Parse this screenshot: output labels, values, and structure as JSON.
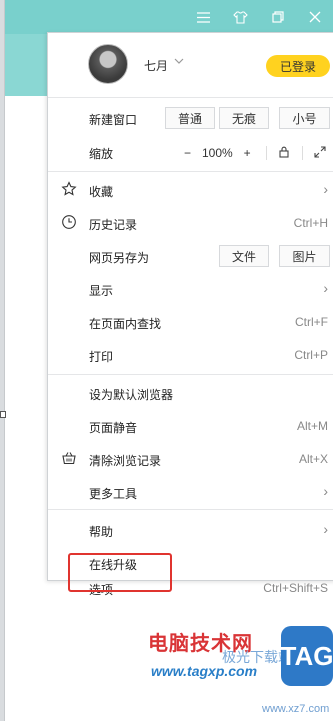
{
  "title_bar": {
    "icons": [
      "menu-icon",
      "skin-icon",
      "minimize-icon",
      "restore-icon",
      "close-icon"
    ],
    "color": "#79d0cc"
  },
  "profile": {
    "username": "七月",
    "login_label": "已登录",
    "login_color": "#ffd21f"
  },
  "new_window": {
    "label": "新建窗口",
    "options": [
      "普通",
      "无痕",
      "小号"
    ]
  },
  "zoom": {
    "label": "缩放",
    "minus": "−",
    "value": "100%",
    "plus": "+",
    "lock_icon": "lock-icon",
    "fullscreen_icon": "fullscreen-icon"
  },
  "items": [
    {
      "label": "收藏",
      "icon": "star-icon",
      "submenu": true
    },
    {
      "label": "历史记录",
      "icon": "clock-icon",
      "shortcut": "Ctrl+H"
    },
    {
      "label": "网页另存为",
      "options": [
        "文件",
        "图片"
      ]
    },
    {
      "label": "显示",
      "submenu": true
    },
    {
      "label": "在页面内查找",
      "shortcut": "Ctrl+F"
    },
    {
      "label": "打印",
      "shortcut": "Ctrl+P"
    },
    {
      "label": "设为默认浏览器"
    },
    {
      "label": "页面静音",
      "shortcut": "Alt+M"
    },
    {
      "label": "清除浏览记录",
      "icon": "basket-icon",
      "shortcut": "Alt+X"
    },
    {
      "label": "更多工具",
      "submenu": true
    },
    {
      "label": "帮助",
      "submenu": true
    },
    {
      "label": "在线升级"
    },
    {
      "label": "选项",
      "shortcut": "Ctrl+Shift+S"
    }
  ],
  "highlight_color": "#e0342f",
  "watermark": {
    "title": "电脑技术网",
    "url": "www.tagxp.com",
    "cn": "极光下载站",
    "sub": "www.xz7.com",
    "logo": "TAG"
  }
}
